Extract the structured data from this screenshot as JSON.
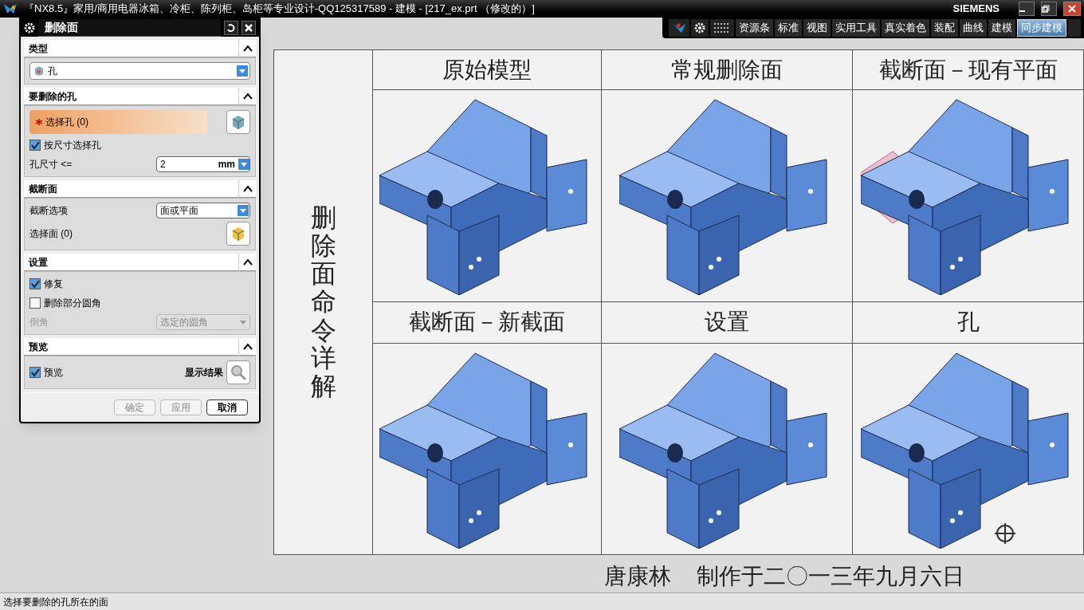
{
  "window": {
    "title": "『NX8.5』家用/商用电器冰箱、冷柜、陈列柜、岛柜等专业设计-QQ125317589 - 建模 - [217_ex.prt （修改的）]",
    "brand": "SIEMENS"
  },
  "toolbar": {
    "tabs": [
      {
        "label": "资源条",
        "selected": false
      },
      {
        "label": "标准",
        "selected": false
      },
      {
        "label": "视图",
        "selected": false
      },
      {
        "label": "实用工具",
        "selected": false
      },
      {
        "label": "真实着色",
        "selected": false
      },
      {
        "label": "装配",
        "selected": false
      },
      {
        "label": "曲线",
        "selected": false
      },
      {
        "label": "建模",
        "selected": false
      },
      {
        "label": "同步建模",
        "selected": true
      }
    ]
  },
  "dialog": {
    "title": "删除面",
    "sections": [
      {
        "title": "类型",
        "expanded": true,
        "rows": [
          {
            "kind": "dropdown",
            "value": "孔"
          }
        ]
      },
      {
        "title": "要删除的孔",
        "expanded": true,
        "rows": [
          {
            "kind": "select",
            "label": "选择孔 (0)",
            "required": true
          },
          {
            "kind": "checkbox",
            "label": "按尺寸选择孔",
            "checked": true
          },
          {
            "kind": "number",
            "label": "孔尺寸 <=",
            "value": "2",
            "unit": "mm"
          }
        ]
      },
      {
        "title": "截断面",
        "expanded": true,
        "rows": [
          {
            "kind": "option",
            "label": "截断选项",
            "value": "面或平面",
            "disabled": false
          },
          {
            "kind": "pick",
            "label": "选择面 (0)"
          }
        ]
      },
      {
        "title": "设置",
        "expanded": true,
        "rows": [
          {
            "kind": "checkbox",
            "label": "修复",
            "checked": true
          },
          {
            "kind": "checkbox",
            "label": "删除部分圆角",
            "checked": false
          },
          {
            "kind": "option",
            "label": "倒角",
            "value": "选定的圆角",
            "disabled": true
          }
        ]
      },
      {
        "title": "预览",
        "expanded": true,
        "rows": [
          {
            "kind": "preview",
            "label": "预览",
            "checked": true,
            "button_label": "显示结果"
          }
        ]
      }
    ],
    "buttons": [
      {
        "label": "确定",
        "disabled": true
      },
      {
        "label": "应用",
        "disabled": true
      },
      {
        "label": "取消",
        "disabled": false
      }
    ]
  },
  "drawing": {
    "side_title": "删除面命令详解",
    "cells": [
      {
        "caption": "原始模型",
        "section_plane": false
      },
      {
        "caption": "常规删除面",
        "section_plane": false
      },
      {
        "caption": "截断面－现有平面",
        "section_plane": true
      },
      {
        "caption": "截断面－新截面",
        "section_plane": false
      },
      {
        "caption": "设置",
        "section_plane": false
      },
      {
        "caption": "孔",
        "section_plane": false
      }
    ],
    "signature": [
      "唐康林",
      "制作于二〇一三年九月六日"
    ]
  },
  "status_bar": {
    "prompt": "选择要删除的孔所在的面"
  }
}
